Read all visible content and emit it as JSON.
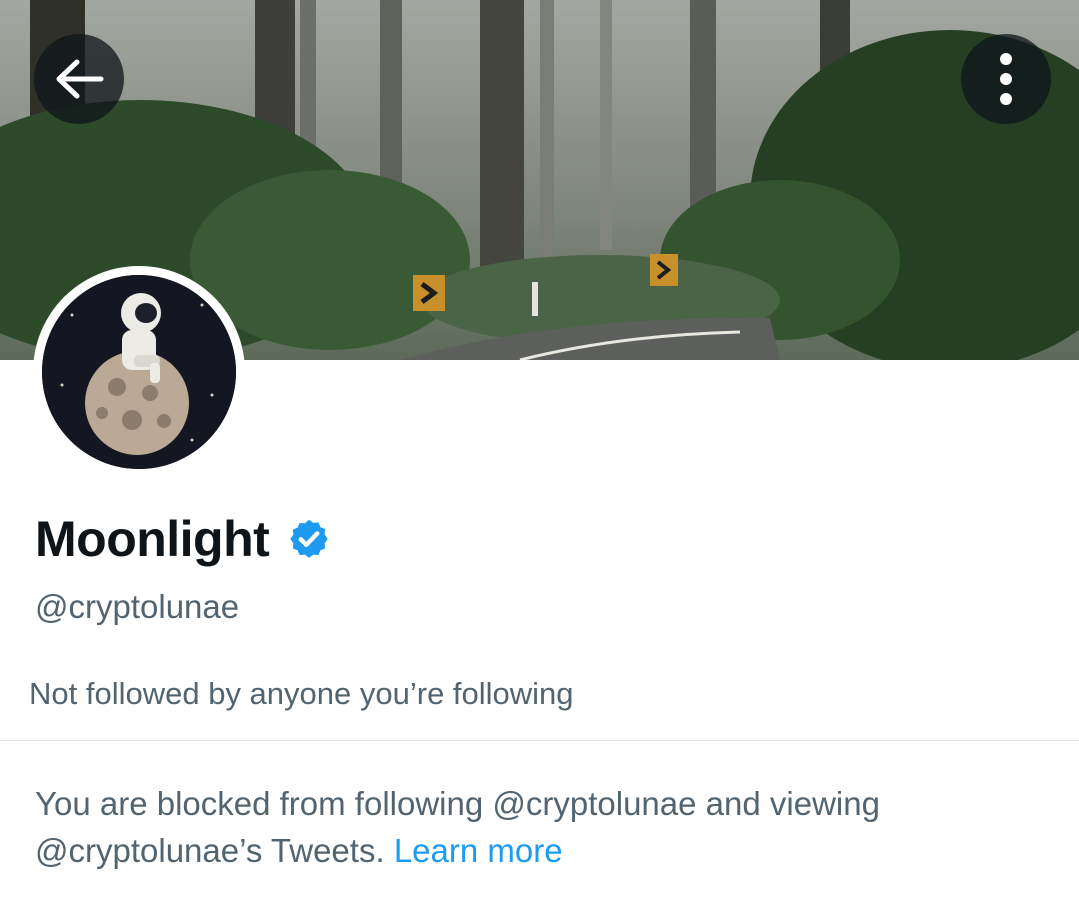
{
  "header": {
    "back_icon": "arrow-left-icon",
    "menu_icon": "more-vertical-icon"
  },
  "profile": {
    "display_name": "Moonlight",
    "verified_icon": "verified-badge-icon",
    "handle": "@cryptolunae",
    "followed_by_text": "Not followed by anyone you’re following"
  },
  "blocked": {
    "message": "You are blocked from following @cryptolunae and viewing @cryptolunae’s Tweets.",
    "learn_more_label": "Learn more"
  },
  "colors": {
    "accent": "#1d9bf0",
    "text_primary": "#0f1419",
    "text_secondary": "#536471"
  }
}
